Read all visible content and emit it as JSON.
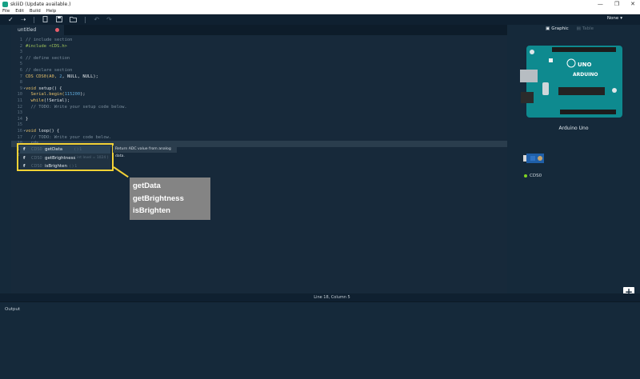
{
  "window": {
    "title": "skiiiD (Update available.)",
    "controls": [
      "—",
      "❐",
      "✕"
    ]
  },
  "menu": [
    "File",
    "Edit",
    "Build",
    "Help"
  ],
  "toolbar": {
    "board_select": "None",
    "icons": [
      "check-icon",
      "arrow-right-icon",
      "new-file-icon",
      "save-icon",
      "folder-icon",
      "undo-icon",
      "redo-icon"
    ]
  },
  "tab": {
    "name": "untitled"
  },
  "code_lines": [
    {
      "n": "1",
      "segments": [
        {
          "t": "// include section",
          "c": "cm"
        }
      ]
    },
    {
      "n": "2",
      "segments": [
        {
          "t": "#include <CDS.h>",
          "c": "pp"
        }
      ]
    },
    {
      "n": "3",
      "segments": []
    },
    {
      "n": "4",
      "segments": [
        {
          "t": "// define section",
          "c": "cm"
        }
      ]
    },
    {
      "n": "5",
      "segments": []
    },
    {
      "n": "6",
      "segments": [
        {
          "t": "// declare section",
          "c": "cm"
        }
      ]
    },
    {
      "n": "7",
      "segments": [
        {
          "t": "CDS CDS0(A0, ",
          "c": "kw"
        },
        {
          "t": "2",
          "c": "num"
        },
        {
          "t": ", NULL, NULL);",
          "c": "nul"
        }
      ]
    },
    {
      "n": "8",
      "segments": []
    },
    {
      "n": "9",
      "fold": true,
      "segments": [
        {
          "t": "void ",
          "c": "kw"
        },
        {
          "t": "setup() {",
          "c": "fn"
        }
      ]
    },
    {
      "n": "10",
      "segments": [
        {
          "t": "  Serial.begin(",
          "c": "kw"
        },
        {
          "t": "115200",
          "c": "num"
        },
        {
          "t": ");",
          "c": "fn"
        }
      ]
    },
    {
      "n": "11",
      "segments": [
        {
          "t": "  while",
          "c": "kw"
        },
        {
          "t": "(!Serial);",
          "c": "fn"
        }
      ]
    },
    {
      "n": "12",
      "segments": [
        {
          "t": "  // TODO: Write your setup code below.",
          "c": "cm"
        }
      ]
    },
    {
      "n": "13",
      "segments": []
    },
    {
      "n": "14",
      "segments": [
        {
          "t": "}",
          "c": "fn"
        }
      ]
    },
    {
      "n": "15",
      "segments": []
    },
    {
      "n": "16",
      "fold": true,
      "segments": [
        {
          "t": "void ",
          "c": "kw"
        },
        {
          "t": "loop() {",
          "c": "fn"
        }
      ]
    },
    {
      "n": "17",
      "segments": [
        {
          "t": "  // TODO: Write your code below.",
          "c": "cm"
        }
      ]
    },
    {
      "n": "18",
      "current": true,
      "segments": [
        {
          "t": "  cds",
          "c": "cm"
        }
      ]
    },
    {
      "n": "19",
      "segments": [
        {
          "t": "}",
          "c": "fn"
        }
      ]
    },
    {
      "n": "20",
      "segments": []
    }
  ],
  "autocomplete": {
    "items": [
      {
        "kind": "f",
        "type": "CDS0",
        "name": "getData",
        "sig": "( ) 1"
      },
      {
        "kind": "f",
        "type": "CDS0",
        "name": "getBrightness",
        "sig": "( int level = 1024 )"
      },
      {
        "kind": "f",
        "type": "CDS0",
        "name": "isBrighten",
        "sig": "( ) 1"
      }
    ],
    "tooltip": "Return ADC value from analog data."
  },
  "callout": [
    "getData",
    "getBrightness",
    "isBrighten"
  ],
  "status": {
    "position": "Line 18, Column 5"
  },
  "output": {
    "label": "Output"
  },
  "right_panel": {
    "tabs": [
      {
        "label": "Graphic",
        "active": true
      },
      {
        "label": "Table",
        "active": false
      }
    ],
    "board_name": "Arduino Uno",
    "board_logo": "ARDUINO",
    "board_model": "UNO",
    "component": "CDS0",
    "add_button": "+"
  },
  "colors": {
    "editor_bg": "#17293a",
    "highlight": "#f4d236",
    "comment": "#7a8d9c",
    "keyword": "#e7c069",
    "preprocessor": "#9fc35a",
    "number": "#5fa9d9",
    "board_teal": "#0e8a8f"
  }
}
